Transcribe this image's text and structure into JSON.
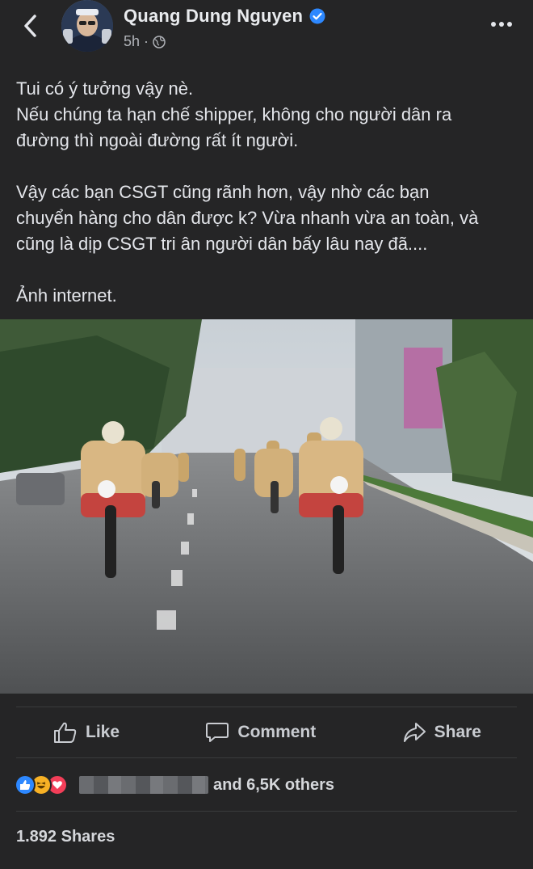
{
  "header": {
    "author": "Quang Dung Nguyen",
    "time": "5h",
    "separator": "·"
  },
  "post": {
    "paragraphs": [
      [
        "Tui có ý tưởng vậy nè.",
        "Nếu chúng ta hạn chế shipper, không cho người dân ra",
        "đường thì ngoài đường rất ít người."
      ],
      [
        "Vậy các bạn CSGT cũng rãnh hơn, vậy nhờ các bạn",
        "chuyển hàng cho dân được k? Vừa nhanh vừa an toàn, và",
        "cũng là dịp CSGT tri ân người dân bấy lâu nay đã...."
      ],
      [
        "Ảnh internet."
      ]
    ]
  },
  "actions": {
    "like": "Like",
    "comment": "Comment",
    "share": "Share"
  },
  "reactions": {
    "icons": [
      "like-reaction",
      "haha-reaction",
      "love-reaction"
    ],
    "count_text": "and 6,5K others"
  },
  "shares_text": "1.892 Shares",
  "colors": {
    "background": "#252526",
    "verified": "#2d88ff",
    "like": "#2d88ff",
    "love": "#f33e58",
    "haha": "#f7b125"
  }
}
